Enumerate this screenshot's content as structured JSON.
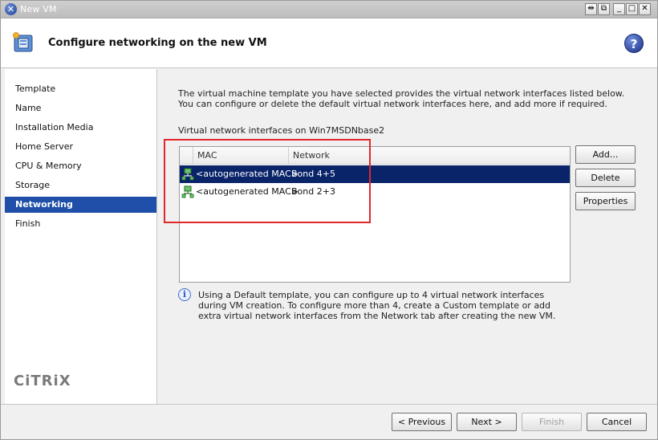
{
  "window": {
    "title": "New VM",
    "controls": [
      "⇹",
      "⧉",
      "_",
      "□",
      "✕"
    ]
  },
  "header": {
    "title": "Configure networking on the new VM",
    "help_symbol": "?"
  },
  "sidebar": {
    "items": [
      {
        "label": "Template"
      },
      {
        "label": "Name"
      },
      {
        "label": "Installation Media"
      },
      {
        "label": "Home Server"
      },
      {
        "label": "CPU & Memory"
      },
      {
        "label": "Storage"
      },
      {
        "label": "Networking"
      },
      {
        "label": "Finish"
      }
    ],
    "active_index": 6,
    "brand": "CiTRiX"
  },
  "main": {
    "description": "The virtual machine template you have selected provides the virtual network interfaces listed below. You can configure or delete the default virtual network interfaces here, and add more if required.",
    "list_label": "Virtual network interfaces on Win7MSDNbase2",
    "columns": [
      "MAC",
      "Network"
    ],
    "rows": [
      {
        "mac": "<autogenerated MAC>",
        "network": "Bond 4+5",
        "selected": true
      },
      {
        "mac": "<autogenerated MAC>",
        "network": "Bond 2+3",
        "selected": false
      }
    ],
    "buttons": {
      "add": "Add...",
      "delete": "Delete",
      "properties": "Properties"
    },
    "info_text": "Using a Default template, you can configure up to 4 virtual network interfaces during VM creation. To configure more than 4, create a Custom template or add extra virtual network interfaces from the Network tab after creating the new VM.",
    "info_symbol": "i"
  },
  "footer": {
    "previous": "< Previous",
    "next": "Next >",
    "finish": "Finish",
    "cancel": "Cancel"
  },
  "colors": {
    "selection": "#0a246a",
    "sidebar_active": "#1f4fa8",
    "highlight": "#e0282c"
  },
  "icons": {
    "app": "xencenter-icon",
    "header": "vm-icon",
    "help": "help-icon",
    "nic": "network-interface-icon",
    "info": "info-icon"
  }
}
